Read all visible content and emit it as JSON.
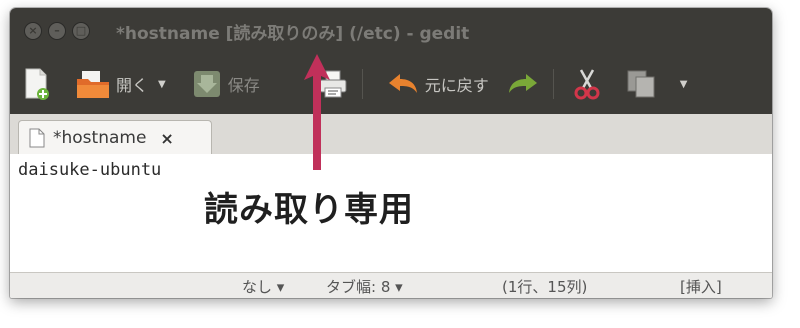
{
  "window": {
    "title": "*hostname [読み取りのみ] (/etc) - gedit",
    "controls": [
      "close",
      "minimize",
      "maximize"
    ]
  },
  "toolbar": {
    "new_icon": "new-document-icon",
    "open_label": "開く",
    "save_label": "保存",
    "print_icon": "printer-icon",
    "undo_label": "元に戻す",
    "redo_icon": "redo-icon",
    "cut_icon": "scissors-icon",
    "copy_icon": "copy-icon"
  },
  "tab": {
    "label": "*hostname",
    "close": "×"
  },
  "editor": {
    "content": "daisuke-ubuntu"
  },
  "statusbar": {
    "language": "なし ▾",
    "tab_width": "タブ幅: 8 ▾",
    "position": "(1行、15列)",
    "mode": "[挿入]"
  },
  "annotation": {
    "label": "読み取り専用",
    "color": "#c0305a"
  }
}
